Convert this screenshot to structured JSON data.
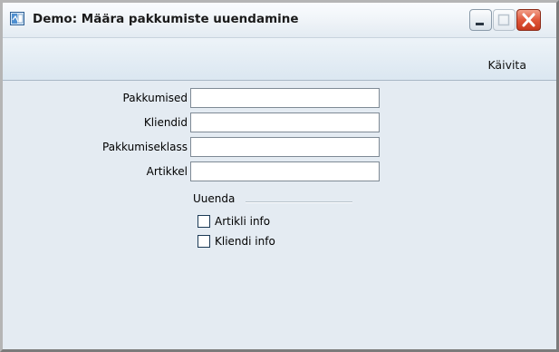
{
  "window": {
    "title": "Demo: Määra pakkumiste uuendamine",
    "icon": "window-app-icon",
    "controls": [
      "minimize-icon",
      "maximize-icon",
      "close-icon"
    ]
  },
  "menu": {
    "items": [
      {
        "label": "Käivita"
      }
    ]
  },
  "form": {
    "fields": [
      {
        "label": "Pakkumised",
        "value": ""
      },
      {
        "label": "Kliendid",
        "value": ""
      },
      {
        "label": "Pakkumiseklass",
        "value": ""
      },
      {
        "label": "Artikkel",
        "value": ""
      }
    ],
    "group": {
      "title": "Uuenda",
      "options": [
        {
          "label": "Artikli info",
          "checked": false
        },
        {
          "label": "Kliendi info",
          "checked": false
        }
      ]
    }
  },
  "colors": {
    "close_button": "#d9472b",
    "background": "#e4ebf2"
  }
}
